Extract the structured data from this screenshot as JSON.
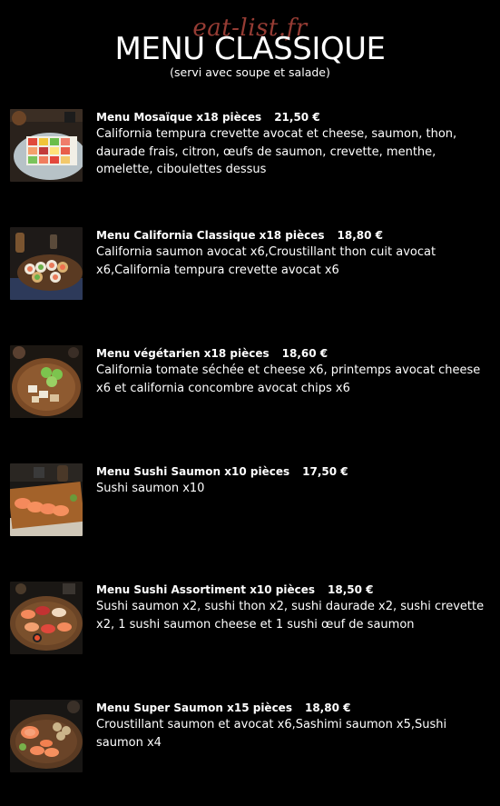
{
  "watermark": "eat-list.fr",
  "menu": {
    "title": "MENU CLASSIQUE",
    "subtitle": "(servi avec soupe et salade)"
  },
  "items": [
    {
      "name": "Menu Mosaïque x18 pièces",
      "price": "21,50 €",
      "description": "California tempura crevette avocat et cheese, saumon, thon, daurade frais, citron, œufs de saumon, crevette, menthe, omelette, ciboulettes dessus",
      "image_icon": "mosaic-sushi-plate-icon"
    },
    {
      "name": "Menu California Classique x18 pièces",
      "price": "18,80 €",
      "description": "California saumon avocat x6,Croustillant thon cuit avocat x6,California tempura crevette avocat x6",
      "image_icon": "california-rolls-plate-icon"
    },
    {
      "name": "Menu végétarien x18 pièces",
      "price": "18,60 €",
      "description": "California tomate séchée et cheese x6, printemps avocat cheese x6 et california concombre avocat chips x6",
      "image_icon": "vegetarian-rolls-plate-icon"
    },
    {
      "name": "Menu Sushi Saumon x10 pièces",
      "price": "17,50 €",
      "description": "Sushi saumon x10",
      "image_icon": "salmon-sushi-board-icon"
    },
    {
      "name": "Menu Sushi Assortiment x10 pièces",
      "price": "18,50 €",
      "description": "Sushi saumon x2, sushi thon x2, sushi daurade x2, sushi crevette x2, 1 sushi saumon cheese et 1 sushi œuf de saumon",
      "image_icon": "assorted-sushi-plate-icon"
    },
    {
      "name": "Menu Super Saumon x15 pièces",
      "price": "18,80 €",
      "description": "Croustillant saumon et avocat x6,Sashimi saumon x5,Sushi saumon x4",
      "image_icon": "salmon-combo-plate-icon"
    }
  ]
}
